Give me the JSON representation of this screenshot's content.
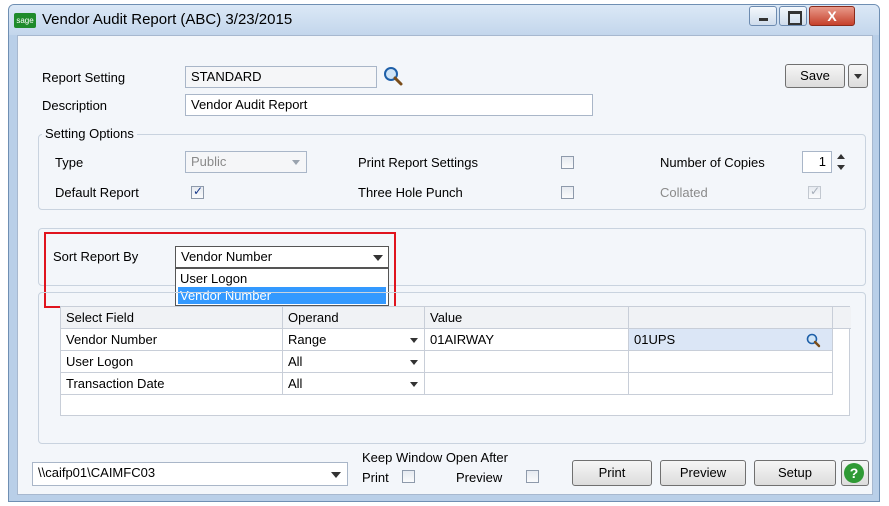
{
  "window": {
    "title": "Vendor Audit Report (ABC) 3/23/2015",
    "logo_text": "sage",
    "close_glyph": "X"
  },
  "report_setting": {
    "label": "Report Setting",
    "value": "STANDARD"
  },
  "description": {
    "label": "Description",
    "value": "Vendor Audit Report"
  },
  "save_label": "Save",
  "setting_options": {
    "title": "Setting Options",
    "type_label": "Type",
    "type_value": "Public",
    "default_report_label": "Default Report",
    "default_report_checked": true,
    "print_report_settings_label": "Print Report Settings",
    "three_hole_punch_label": "Three Hole Punch",
    "number_of_copies_label": "Number of Copies",
    "number_of_copies_value": "1",
    "collated_label": "Collated"
  },
  "sort": {
    "label": "Sort Report By",
    "selected": "Vendor Number",
    "options": [
      "User Logon",
      "Vendor Number"
    ]
  },
  "grid": {
    "headers": [
      "Select Field",
      "Operand",
      "Value"
    ],
    "rows": [
      {
        "field": "Vendor Number",
        "operand": "Range",
        "value": "01AIRWAY",
        "value2": "01UPS"
      },
      {
        "field": "User Logon",
        "operand": "All",
        "value": "",
        "value2": ""
      },
      {
        "field": "Transaction Date",
        "operand": "All",
        "value": "",
        "value2": ""
      }
    ]
  },
  "printer": {
    "value": "\\\\caifp01\\CAIMFC03"
  },
  "keep_open": {
    "label": "Keep Window Open After",
    "print_label": "Print",
    "preview_label": "Preview"
  },
  "buttons": {
    "print": "Print",
    "preview": "Preview",
    "setup": "Setup",
    "help": "?"
  },
  "colors": {
    "highlight": "#3399ff",
    "annotation_red": "#e0141e",
    "help_green": "#2f9a35"
  }
}
